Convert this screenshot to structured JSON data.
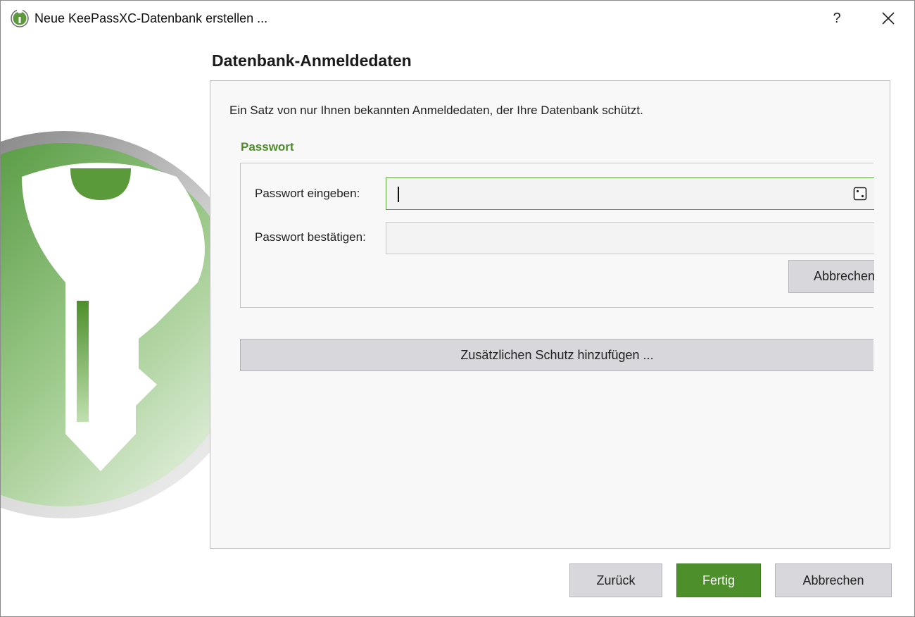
{
  "window": {
    "title": "Neue KeePassXC-Datenbank erstellen ...",
    "help_label": "?",
    "icons": {
      "app": "keepassxc-logo-icon",
      "close": "close-icon",
      "dice": "dice-icon"
    }
  },
  "page": {
    "title": "Datenbank-Anmeldedaten",
    "description": "Ein Satz von nur Ihnen bekannten Anmeldedaten, der Ihre Datenbank schützt."
  },
  "password_group": {
    "title": "Passwort",
    "enter_label": "Passwort eingeben:",
    "enter_value": "",
    "confirm_label": "Passwort bestätigen:",
    "confirm_value": "",
    "cancel_label": "Abbrechen"
  },
  "add_protection_label": "Zusätzlichen Schutz hinzufügen ...",
  "footer": {
    "back_label": "Zurück",
    "finish_label": "Fertig",
    "cancel_label": "Abbrechen"
  },
  "colors": {
    "accent_green": "#4d8f2b",
    "group_title_green": "#4d8c2a",
    "focus_border": "#5b9a3a"
  }
}
